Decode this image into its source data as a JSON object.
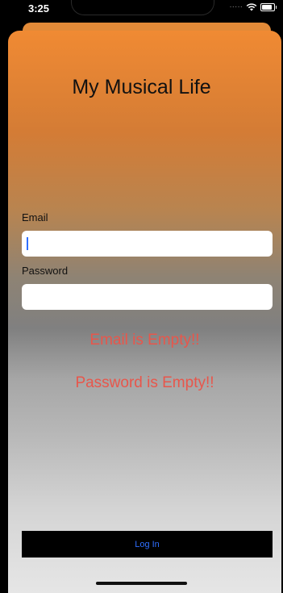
{
  "status_bar": {
    "time": "3:25"
  },
  "header": {
    "title": "My Musical Life"
  },
  "form": {
    "email_label": "Email",
    "email_value": "",
    "password_label": "Password",
    "password_value": ""
  },
  "errors": {
    "email": "Email is Empty!!",
    "password": "Password is Empty!!"
  },
  "login_button": {
    "label": "Log In"
  },
  "colors": {
    "accent_orange": "#f08a33",
    "error_red": "#e8564b",
    "link_blue": "#2f6fff"
  }
}
